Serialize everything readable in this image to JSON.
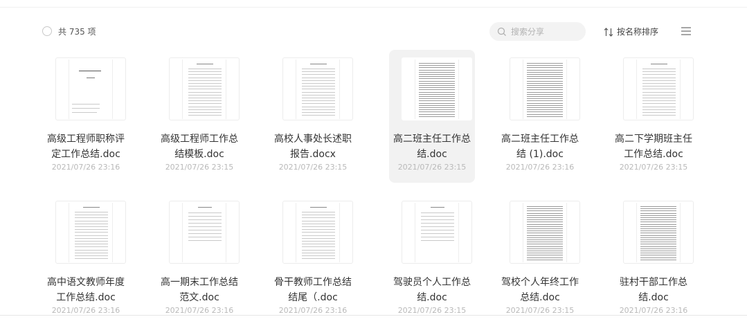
{
  "toolbar": {
    "count_label": "共 735 项",
    "search_placeholder": "搜索分享",
    "sort_label": "按名称排序"
  },
  "files": [
    {
      "name_line1": "高级工程师职称评",
      "name_line2": "定工作总结.doc",
      "date": "2021/07/26 23:16",
      "selected": false,
      "thumb": "cover"
    },
    {
      "name_line1": "高级工程师工作总",
      "name_line2": "结模板.doc",
      "date": "2021/07/26 23:15",
      "selected": false,
      "thumb": "text"
    },
    {
      "name_line1": "高校人事处长述职",
      "name_line2": "报告.docx",
      "date": "2021/07/26 23:15",
      "selected": false,
      "thumb": "text"
    },
    {
      "name_line1": "高二班主任工作总",
      "name_line2": "结.doc",
      "date": "2021/07/26 23:15",
      "selected": true,
      "thumb": "dense"
    },
    {
      "name_line1": "高二班主任工作总",
      "name_line2": "结 (1).doc",
      "date": "2021/07/26 23:16",
      "selected": false,
      "thumb": "dense"
    },
    {
      "name_line1": "高二下学期班主任",
      "name_line2": "工作总结.doc",
      "date": "2021/07/26 23:15",
      "selected": false,
      "thumb": "text"
    },
    {
      "name_line1": "高中语文教师年度",
      "name_line2": "工作总结.doc",
      "date": "2021/07/26 23:16",
      "selected": false,
      "thumb": "text"
    },
    {
      "name_line1": "高一期末工作总结",
      "name_line2": "范文.doc",
      "date": "2021/07/26 23:16",
      "selected": false,
      "thumb": "sparse"
    },
    {
      "name_line1": "骨干教师工作总结",
      "name_line2": "结尾（.doc",
      "date": "2021/07/26 23:16",
      "selected": false,
      "thumb": "text"
    },
    {
      "name_line1": "驾驶员个人工作总",
      "name_line2": "结.doc",
      "date": "2021/07/26 23:15",
      "selected": false,
      "thumb": "sparse"
    },
    {
      "name_line1": "驾校个人年终工作",
      "name_line2": "总结.doc",
      "date": "2021/07/26 23:15",
      "selected": false,
      "thumb": "dense"
    },
    {
      "name_line1": "驻村干部工作总",
      "name_line2": "结.doc",
      "date": "2021/07/26 23:16",
      "selected": false,
      "thumb": "dense"
    }
  ]
}
